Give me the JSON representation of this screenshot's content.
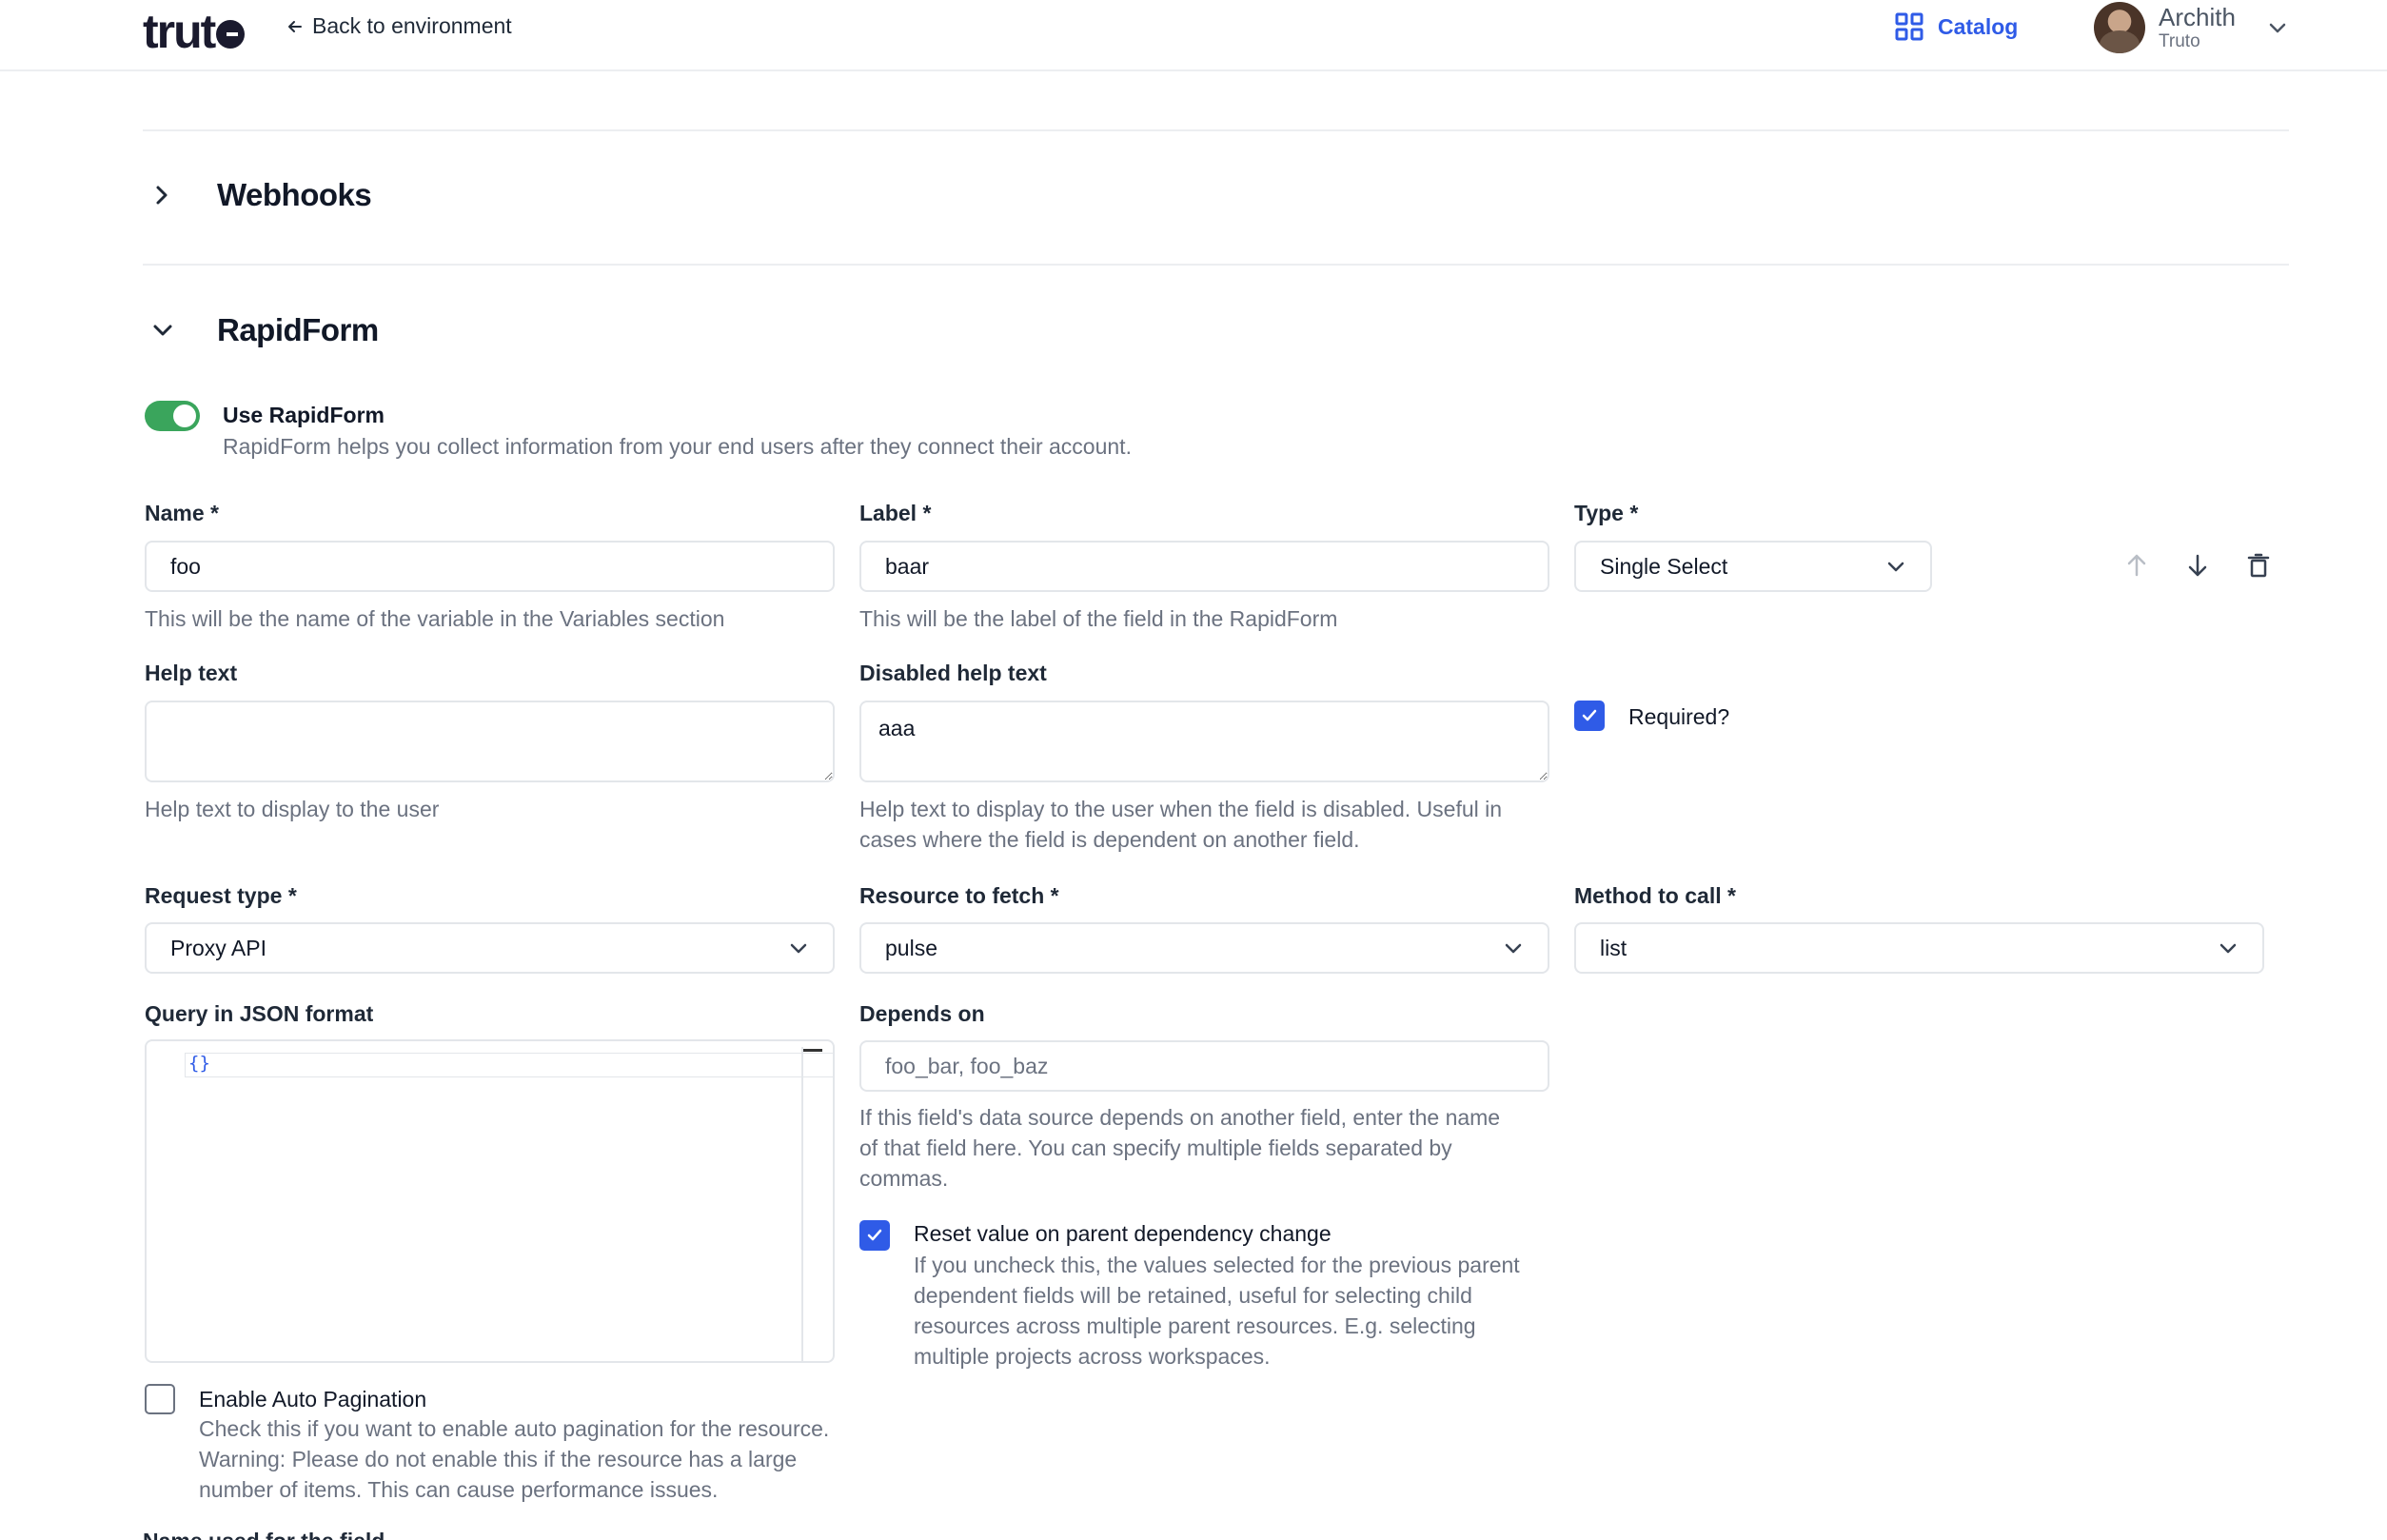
{
  "header": {
    "logo": "truto",
    "back_link": "Back to environment",
    "catalog": "Catalog",
    "user_name": "Archith",
    "user_org": "Truto"
  },
  "sections": {
    "webhooks": "Webhooks",
    "rapidform": "RapidForm"
  },
  "rapidform": {
    "toggle_label": "Use RapidForm",
    "toggle_desc": "RapidForm helps you collect information from your end users after they connect their account.",
    "toggle_on": true,
    "name": {
      "label": "Name *",
      "value": "foo",
      "hint": "This will be the name of the variable in the Variables section"
    },
    "field_label": {
      "label": "Label *",
      "value": "baar",
      "hint": "This will be the label of the field in the RapidForm"
    },
    "type": {
      "label": "Type *",
      "value": "Single Select"
    },
    "help_text": {
      "label": "Help text",
      "value": "",
      "hint": "Help text to display to the user"
    },
    "disabled_help_text": {
      "label": "Disabled help text",
      "value": "aaa",
      "hint_line1": "Help text to display to the user when the field is disabled. Useful in",
      "hint_line2": "cases where the field is dependent on another field."
    },
    "required": {
      "label": "Required?",
      "checked": true
    },
    "request_type": {
      "label": "Request type *",
      "value": "Proxy API"
    },
    "resource": {
      "label": "Resource to fetch *",
      "value": "pulse"
    },
    "method": {
      "label": "Method to call *",
      "value": "list"
    },
    "query": {
      "label": "Query in JSON format",
      "value": "{}"
    },
    "depends_on": {
      "label": "Depends on",
      "placeholder": "foo_bar, foo_baz",
      "hint_line1": "If this field's data source depends on another field, enter the name",
      "hint_line2": "of that field here. You can specify multiple fields separated by",
      "hint_line3": "commas."
    },
    "reset_value": {
      "label": "Reset value on parent dependency change",
      "checked": true,
      "desc_line1": "If you uncheck this, the values selected for the previous parent",
      "desc_line2": "dependent fields will be retained, useful for selecting child",
      "desc_line3": "resources across multiple parent resources. E.g. selecting",
      "desc_line4": "multiple projects across workspaces."
    },
    "auto_pagination": {
      "label": "Enable Auto Pagination",
      "checked": false,
      "desc_line1": "Check this if you want to enable auto pagination for the resource.",
      "desc_line2": "Warning: Please do not enable this if the resource has a large",
      "desc_line3": "number of items. This can cause performance issues."
    },
    "next_label": "Name used for the field"
  },
  "colors": {
    "accent": "#2f5be7",
    "toggle_on": "#3aa55c"
  }
}
